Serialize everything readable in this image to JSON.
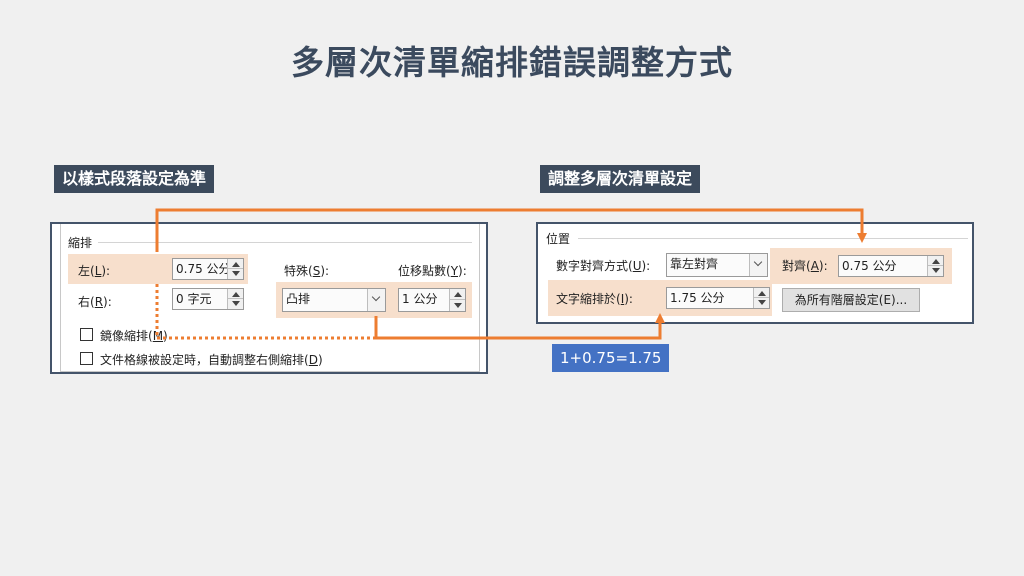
{
  "title": "多層次清單縮排錯誤調整方式",
  "left_section": {
    "label": "以樣式段落設定為準",
    "group_label": "縮排",
    "left_label": "左(",
    "left_key": "L",
    "left_suffix": "):",
    "left_value": "0.75 公分",
    "right_label": "右(",
    "right_key": "R",
    "right_suffix": "):",
    "right_value": "0 字元",
    "special_label": "特殊(",
    "special_key": "S",
    "special_suffix": "):",
    "special_value": "凸排",
    "offset_label": "位移點數(",
    "offset_key": "Y",
    "offset_suffix": "):",
    "offset_value": "1 公分",
    "mirror_label": "鏡像縮排(",
    "mirror_key": "M",
    "mirror_suffix": ")",
    "grid_label": "文件格線被設定時，自動調整右側縮排(",
    "grid_key": "D",
    "grid_suffix": ")"
  },
  "right_section": {
    "label": "調整多層次清單設定",
    "group_label": "位置",
    "number_align_label": "數字對齊方式(",
    "number_align_key": "U",
    "number_align_suffix": "):",
    "number_align_value": "靠左對齊",
    "align_at_label": "對齊(",
    "align_at_key": "A",
    "align_at_suffix": "):",
    "align_at_value": "0.75 公分",
    "text_indent_label": "文字縮排於(",
    "text_indent_key": "I",
    "text_indent_suffix": "):",
    "text_indent_value": "1.75 公分",
    "all_levels_button": "為所有階層設定(E)..."
  },
  "formula": "1+0.75=1.75",
  "colors": {
    "arrow": "#ed7d31",
    "highlight": "#f7dfcc",
    "label_bg": "#3c4a5c",
    "formula_bg": "#4472c4"
  }
}
